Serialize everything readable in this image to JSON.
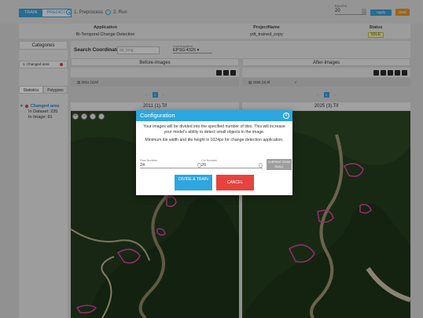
{
  "mode": {
    "train": "TRAIN",
    "predict": "PREDICT"
  },
  "steps": [
    {
      "label": "1. Preprocess",
      "selected": true
    },
    {
      "label": "2. Run",
      "selected": false
    }
  ],
  "epochs": {
    "label": "Epochs",
    "value": "20"
  },
  "toolbar": {
    "apply_label": "Apply",
    "start_label": "Start"
  },
  "project_table": {
    "headers": [
      "Application",
      "ProjectName",
      "Status"
    ],
    "row": [
      "Bi-Temporal Change Detection",
      "ydt_trained_copy",
      "IDLE"
    ]
  },
  "categories": {
    "title": "Categories",
    "item": "1. Changed area"
  },
  "tabs": [
    "Statistics",
    "Polygons"
  ],
  "stats": {
    "class": "Changed area",
    "in_dataset": "In Dataset: 235",
    "in_image": "In Image: 61"
  },
  "search": {
    "label": "Search Coordinates:",
    "placeholder": "lat, long"
  },
  "coord_system": {
    "label": "Coord-system",
    "value": "EPSG:4326"
  },
  "before": {
    "title": "Before-Images",
    "file": "2011 (1).tif",
    "page": "1",
    "image_title": "2011 (1).Tif"
  },
  "after": {
    "title": "After-Images",
    "file": "2025 (3).tif",
    "page": "1",
    "image_title": "2025 (3).Tif"
  },
  "modal": {
    "title": "Configuration",
    "text1": "Your images will be divided into the specified number of tiles. This will increase your model's ability to detect small objects in the image.",
    "text2": "Minimum tile width and tile height is 1024px for change detection application.",
    "row_label": "Row Number",
    "row_value": "24",
    "col_label": "Col Number",
    "col_value": "20",
    "zoom_button": "CURRENT ZOOM SCALE",
    "divide_button": "DIVIDE & TRAIN",
    "cancel_button": "CANCEL"
  },
  "colors": {
    "accent": "#2ea6df",
    "cancel": "#e8423c",
    "polygon": "#d9459f",
    "start": "#e8962a"
  }
}
